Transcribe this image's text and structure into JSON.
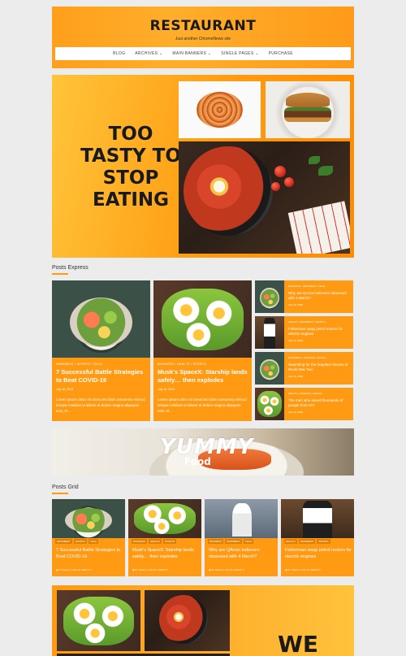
{
  "header": {
    "title": "RESTAURANT",
    "tagline": "Just another ChromeNews site"
  },
  "nav": {
    "items": [
      "BLOG",
      "ARCHIVES ⌄",
      "MAIN BANNERS ⌄",
      "SINGLE PAGES ⌄",
      "PURCHASE"
    ]
  },
  "hero": {
    "headline": "TOO TASTY TO STOP EATING"
  },
  "posts_express": {
    "title": "Posts Express",
    "big": [
      {
        "tags": "NEWSBEAT • SPORTS • TECH",
        "title": "7 Successful Battle Strategies to Beat COVID-19",
        "meta": "July 16, 2018",
        "excerpt": "Lorem ipsum dolor sit amet,sed diam nonummy eirmod tempor invidunt ut labore et dolore magna aliquyam erat, At…"
      },
      {
        "tags": "BUSINESS • HEALTH • SPORTS",
        "title": "Musk's SpaceX: Starship lands safely… then explodes",
        "meta": "July 16, 2018",
        "excerpt": "Lorem ipsum dolor sit amet,sed diam nonummy eirmod tempor invidunt ut labore et dolore magna aliquyam erat, At…"
      }
    ],
    "small": [
      {
        "tags": "BUSINESS • NEWSBEAT • TECH",
        "title": "Why are QAnon believers obsessed with 4 March?",
        "meta": "July 16, 2018"
      },
      {
        "tags": "HEALTH • NEWSBEAT • SPORTS",
        "title": "Fisherman swap petrol motors for electric engines",
        "meta": "July 16, 2018"
      },
      {
        "tags": "NEWSBEAT • SCIENCE • WORLD",
        "title": "Searching for the forgotten heroes of World War Two",
        "meta": "July 16, 2018"
      },
      {
        "tags": "HEALTH • SCIENCE • WORLD",
        "title": "The man who saved thousands of people from HIV",
        "meta": "July 16, 2018"
      }
    ]
  },
  "yummy": {
    "line1": "YUMMY",
    "line2": "Food"
  },
  "posts_grid": {
    "title": "Posts Grid",
    "cards": [
      {
        "tags": [
          "NEWSBEAT",
          "SPORTS",
          "TECH"
        ],
        "title": "7 Successful Battle Strategies to Beat COVID-19",
        "meta": "◉ 67 Views   ◷ July 16, 2018   ✉ 0"
      },
      {
        "tags": [
          "BUSINESS",
          "HEALTH",
          "SPORTS"
        ],
        "title": "Musk's SpaceX: Starship lands safely… then explodes",
        "meta": "◉ 87 Views   ◷ July 16, 2018   ✉ 0"
      },
      {
        "tags": [
          "BUSINESS",
          "NEWSBEAT",
          "TECH"
        ],
        "title": "Why are QAnon believers obsessed with 4 March?",
        "meta": "◉ 61 Views   ◷ July 16, 2018   ✉ 0"
      },
      {
        "tags": [
          "HEALTH",
          "NEWSBEAT",
          "SPORTS"
        ],
        "title": "Fisherman swap petrol motors for electric engines",
        "meta": "◉ 67 Views   ◷ July 16, 2018   ✉ 0"
      }
    ]
  },
  "bottom": {
    "text": "WE"
  }
}
